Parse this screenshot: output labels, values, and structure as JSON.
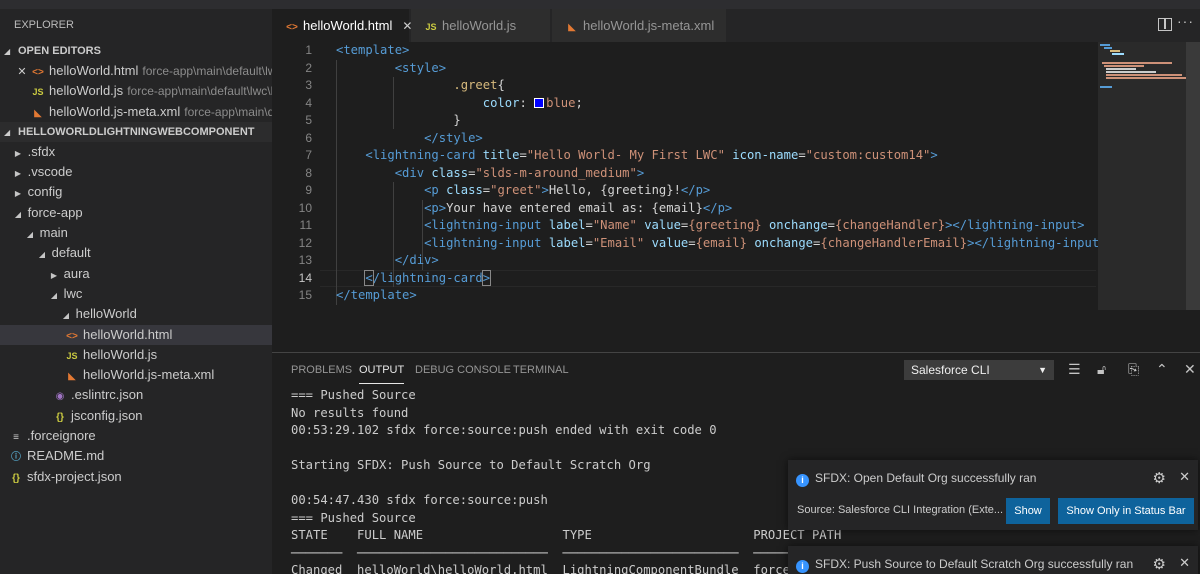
{
  "explorer": {
    "title": "EXPLORER",
    "open_editors": {
      "label": "OPEN EDITORS",
      "items": [
        {
          "name": "helloWorld.html",
          "path": "force-app\\main\\default\\lwc..."
        },
        {
          "name": "helloWorld.js",
          "path": "force-app\\main\\default\\lwc\\h..."
        },
        {
          "name": "helloWorld.js-meta.xml",
          "path": "force-app\\main\\d..."
        }
      ]
    },
    "project": {
      "label": "HELLOWORLDLIGHTNINGWEBCOMPONENT",
      "tree": [
        ".sfdx",
        ".vscode",
        "config",
        "force-app",
        "main",
        "default",
        "aura",
        "lwc",
        "helloWorld",
        "helloWorld.html",
        "helloWorld.js",
        "helloWorld.js-meta.xml",
        ".eslintrc.json",
        "jsconfig.json",
        ".forceignore",
        "README.md",
        "sfdx-project.json"
      ]
    }
  },
  "tabs": [
    {
      "label": "helloWorld.html",
      "icon": "html-icon",
      "active": true
    },
    {
      "label": "helloWorld.js",
      "icon": "js-icon",
      "active": false
    },
    {
      "label": "helloWorld.js-meta.xml",
      "icon": "xml-icon",
      "active": false
    }
  ],
  "editor": {
    "line_numbers": [
      "1",
      "2",
      "3",
      "4",
      "5",
      "6",
      "7",
      "8",
      "9",
      "10",
      "11",
      "12",
      "13",
      "14",
      "15"
    ],
    "current_line": "14",
    "swatch_color": "#0000ff"
  },
  "panel": {
    "tabs": [
      "PROBLEMS",
      "OUTPUT",
      "DEBUG CONSOLE",
      "TERMINAL"
    ],
    "active_tab": "OUTPUT",
    "channel": "Salesforce CLI",
    "output_lines": [
      "=== Pushed Source",
      "No results found",
      "00:53:29.102 sfdx force:source:push ended with exit code 0",
      "",
      "Starting SFDX: Push Source to Default Scratch Org",
      "",
      "00:54:47.430 sfdx force:source:push",
      "=== Pushed Source",
      "STATE    FULL NAME                   TYPE                      PROJECT PATH",
      "───────  ──────────────────────────  ────────────────────────  ───────────",
      "Changed  helloWorld\\helloWorld.html  LightningComponentBundle  force-a"
    ]
  },
  "notifications": [
    {
      "message": "SFDX: Open Default Org successfully ran",
      "source": "Source: Salesforce CLI Integration (Exte...",
      "buttons": [
        "Show",
        "Show Only in Status Bar"
      ]
    },
    {
      "message": "SFDX: Push Source to Default Scratch Org successfully ran"
    }
  ]
}
